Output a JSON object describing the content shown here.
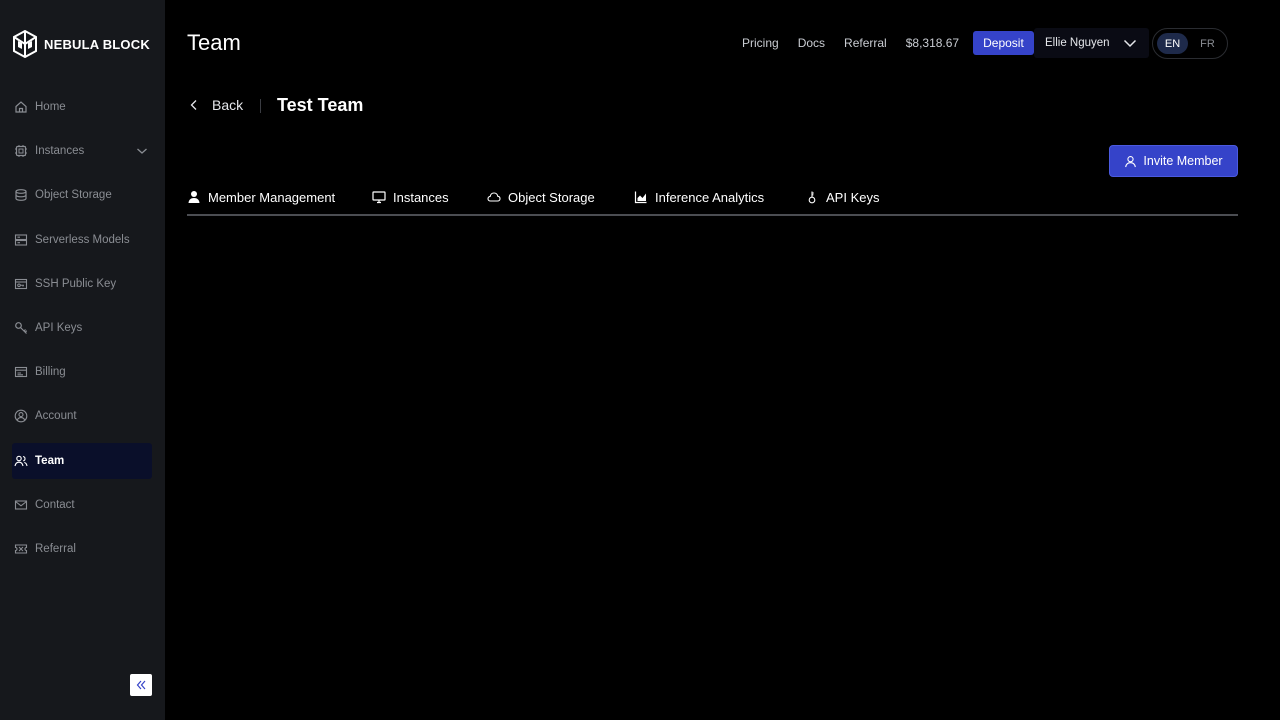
{
  "brand": {
    "name": "NEBULA BLOCK"
  },
  "sidebar": {
    "items": [
      {
        "label": "Home",
        "icon": "home-icon"
      },
      {
        "label": "Instances",
        "icon": "chip-icon"
      },
      {
        "label": "Object Storage",
        "icon": "database-icon"
      },
      {
        "label": "Serverless Models",
        "icon": "server-icon"
      },
      {
        "label": "SSH Public Key",
        "icon": "ssh-key-icon"
      },
      {
        "label": "API Keys",
        "icon": "key-icon"
      },
      {
        "label": "Billing",
        "icon": "billing-icon"
      },
      {
        "label": "Account",
        "icon": "account-icon"
      },
      {
        "label": "Team",
        "icon": "team-icon",
        "active": true
      },
      {
        "label": "Contact",
        "icon": "mail-icon"
      },
      {
        "label": "Referral",
        "icon": "ticket-icon"
      }
    ]
  },
  "header": {
    "title": "Team",
    "links": [
      "Pricing",
      "Docs",
      "Referral"
    ],
    "balance": "$8,318.67",
    "deposit_label": "Deposit",
    "user_name": "Ellie Nguyen",
    "languages": [
      "EN",
      "FR"
    ],
    "active_language": "EN"
  },
  "subheader": {
    "back_label": "Back",
    "team_name": "Test Team"
  },
  "actions": {
    "invite_label": "Invite Member"
  },
  "tabs": [
    {
      "label": "Member Management",
      "icon": "user-icon"
    },
    {
      "label": "Instances",
      "icon": "monitor-icon"
    },
    {
      "label": "Object Storage",
      "icon": "cloud-icon"
    },
    {
      "label": "Inference Analytics",
      "icon": "analytics-icon"
    },
    {
      "label": "API Keys",
      "icon": "key-icon"
    }
  ],
  "colors": {
    "accent": "#3543c9",
    "sidebar_bg": "#16181c",
    "page_bg": "#000000",
    "active_item_bg": "#0a0f2a"
  }
}
